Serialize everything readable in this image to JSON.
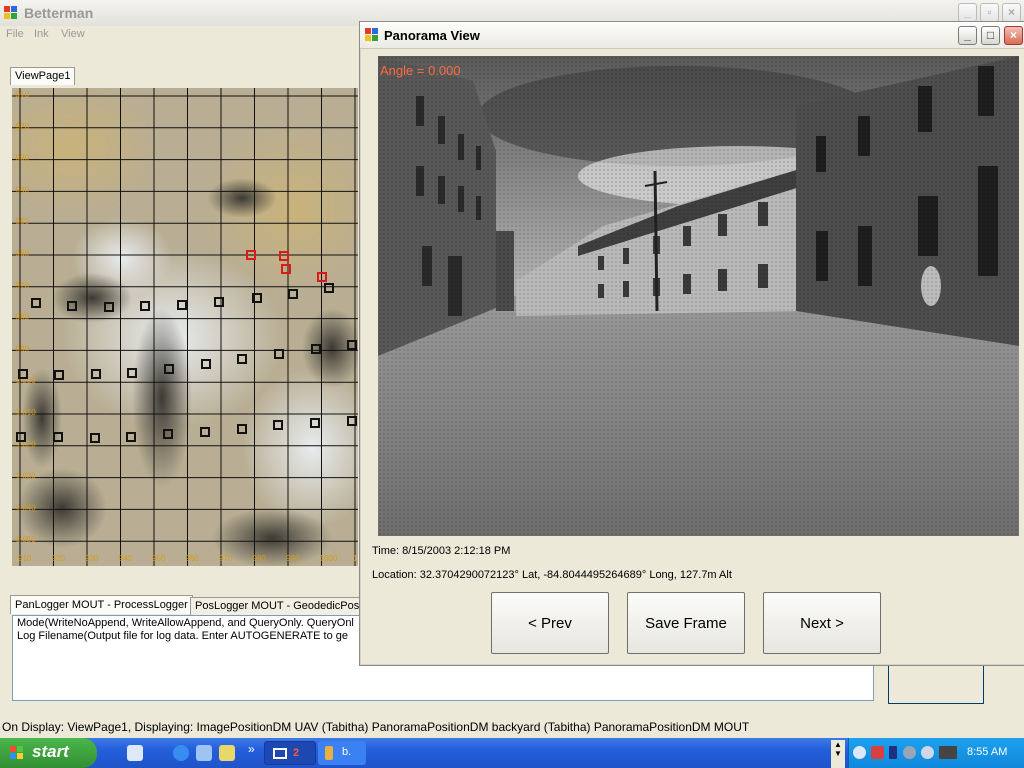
{
  "app": {
    "title": "Betterman",
    "menu": [
      "File",
      "Ink",
      "View"
    ]
  },
  "main": {
    "view_tab": "ViewPage1",
    "logger_tabs": [
      "PanLogger MOUT - ProcessLogger",
      "PosLogger MOUT - GeodedicPosi"
    ],
    "log_lines": [
      "Mode(WriteNoAppend, WriteAllowAppend, and QueryOnly. QueryOnl",
      "Log Filename(Output file for log data. Enter AUTOGENERATE to ge"
    ],
    "status_line": "On Display: ViewPage1, Displaying: ImagePositionDM UAV (Tabitha) PanoramaPositionDM backyard (Tabitha) PanoramaPositionDM MOUT"
  },
  "map": {
    "y_labels": [
      "-910",
      "-920",
      "-930",
      "-940",
      "-950",
      "-960",
      "-970",
      "-980",
      "-990",
      "-1,000",
      "-1,010",
      "-1,020",
      "-1,030",
      "-1,040",
      "-1,050"
    ],
    "x_labels": [
      "910",
      "920",
      "930",
      "940",
      "950",
      "960",
      "970",
      "980",
      "990",
      "1000",
      "1010",
      "1020"
    ],
    "label_color": "#d89a18",
    "marker_color": "#111111",
    "selected_marker_color": "#dd1a1a"
  },
  "panorama": {
    "title": "Panorama View",
    "angle": "Angle = 0.000",
    "time": "Time: 8/15/2003 2:12:18 PM",
    "location": "Location: 32.3704290072123° Lat, -84.8044495264689° Long, 127.7m Alt",
    "buttons": {
      "prev": "< Prev",
      "save": "Save Frame",
      "next": "Next >"
    }
  },
  "taskbar": {
    "start": "start",
    "tasks": [
      "2",
      "b."
    ],
    "clock": "8:55 AM",
    "accent": "#245edc"
  }
}
